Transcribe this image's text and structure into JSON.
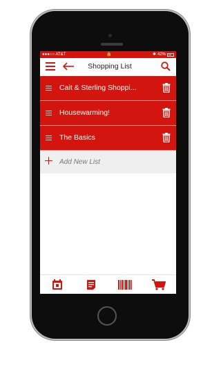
{
  "statusbar": {
    "carrier": "●●●○○ AT&T",
    "lock": "🔒",
    "bluetooth": "✱",
    "battery_percent": "42%"
  },
  "navbar": {
    "title": "Shopping List",
    "menu_icon": "hamburger-menu-icon",
    "back_icon": "arrow-left-icon",
    "search_icon": "search-icon"
  },
  "lists": [
    {
      "label": "Cait & Sterling Shoppi..."
    },
    {
      "label": "Housewarming!"
    },
    {
      "label": "The Basics"
    }
  ],
  "add_list": {
    "label": "Add New List"
  },
  "tabbar": {
    "tabs": [
      {
        "icon": "calendar-coupon-icon"
      },
      {
        "icon": "list-document-icon"
      },
      {
        "icon": "barcode-icon"
      },
      {
        "icon": "shopping-cart-icon"
      }
    ]
  },
  "colors": {
    "accent": "#d2160f",
    "add_row_bg": "#efefef"
  }
}
